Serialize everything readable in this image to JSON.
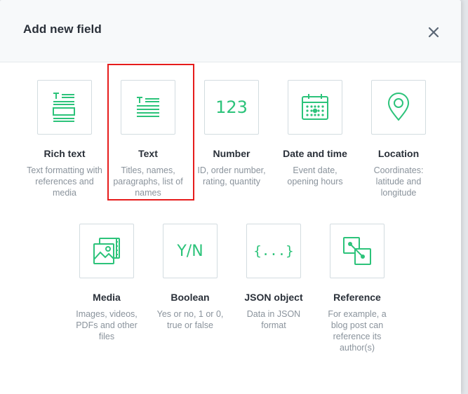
{
  "modal": {
    "title": "Add new field"
  },
  "accent_color": "#2cc37a",
  "highlight_color": "#e61c1c",
  "fields": [
    {
      "name": "Rich text",
      "description": "Text formatting with references and media",
      "icon": "rich-text-icon"
    },
    {
      "name": "Text",
      "description": "Titles, names, paragraphs, list of names",
      "icon": "text-icon",
      "highlighted": true
    },
    {
      "name": "Number",
      "description": "ID, order number, rating, quantity",
      "icon": "number-icon",
      "icon_text": "123"
    },
    {
      "name": "Date and time",
      "description": "Event date, opening hours",
      "icon": "calendar-icon"
    },
    {
      "name": "Location",
      "description": "Coordinates: latitude and longitude",
      "icon": "location-pin-icon"
    },
    {
      "name": "Media",
      "description": "Images, videos, PDFs and other files",
      "icon": "media-icon"
    },
    {
      "name": "Boolean",
      "description": "Yes or no, 1 or 0, true or false",
      "icon": "boolean-icon",
      "icon_text": "Y/N"
    },
    {
      "name": "JSON object",
      "description": "Data in JSON format",
      "icon": "json-icon",
      "icon_text": "{...}"
    },
    {
      "name": "Reference",
      "description": "For example, a blog post can reference its author(s)",
      "icon": "reference-icon"
    }
  ]
}
